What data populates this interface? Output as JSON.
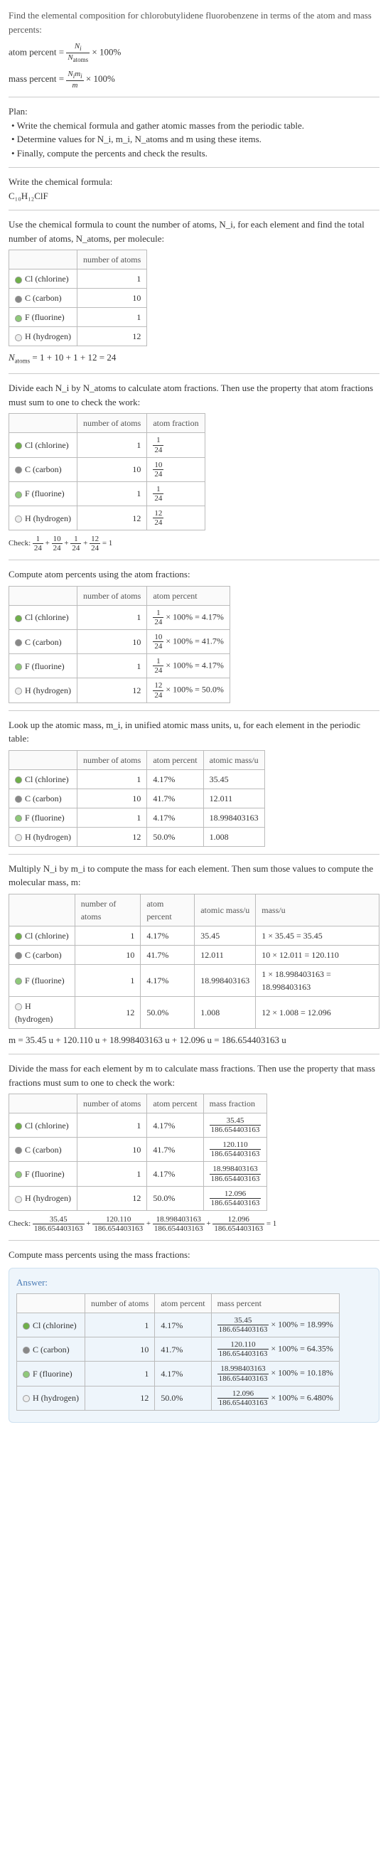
{
  "intro": {
    "prompt": "Find the elemental composition for chlorobutylidene fluorobenzene in terms of the atom and mass percents:",
    "atom_percent_label": "atom percent = ",
    "atom_percent_frac_num": "N_i",
    "atom_percent_frac_den": "N_atoms",
    "times100": " × 100%",
    "mass_percent_label": "mass percent = ",
    "mass_percent_frac_num": "N_i m_i",
    "mass_percent_frac_den": "m"
  },
  "plan": {
    "heading": "Plan:",
    "b1": "• Write the chemical formula and gather atomic masses from the periodic table.",
    "b2": "• Determine values for N_i, m_i, N_atoms and m using these items.",
    "b3": "• Finally, compute the percents and check the results."
  },
  "formula_step": {
    "text": "Write the chemical formula:",
    "formula": "C₁₀H₁₂ClF"
  },
  "count_step": {
    "text": "Use the chemical formula to count the number of atoms, N_i, for each element and find the total number of atoms, N_atoms, per molecule:",
    "header_natoms": "number of atoms",
    "rows": [
      {
        "color": "#6fb04a",
        "el": "Cl (chlorine)",
        "n": "1"
      },
      {
        "color": "#888888",
        "el": "C (carbon)",
        "n": "10"
      },
      {
        "color": "#8fc97a",
        "el": "F (fluorine)",
        "n": "1"
      },
      {
        "color": "#eeeeee",
        "el": "H (hydrogen)",
        "n": "12"
      }
    ],
    "sum": "N_atoms = 1 + 10 + 1 + 12 = 24"
  },
  "atomfrac_step": {
    "text": "Divide each N_i by N_atoms to calculate atom fractions. Then use the property that atom fractions must sum to one to check the work:",
    "header_natoms": "number of atoms",
    "header_frac": "atom fraction",
    "rows": [
      {
        "color": "#6fb04a",
        "el": "Cl (chlorine)",
        "n": "1",
        "fnum": "1",
        "fden": "24"
      },
      {
        "color": "#888888",
        "el": "C (carbon)",
        "n": "10",
        "fnum": "10",
        "fden": "24"
      },
      {
        "color": "#8fc97a",
        "el": "F (fluorine)",
        "n": "1",
        "fnum": "1",
        "fden": "24"
      },
      {
        "color": "#eeeeee",
        "el": "H (hydrogen)",
        "n": "12",
        "fnum": "12",
        "fden": "24"
      }
    ],
    "check_label": "Check: ",
    "check_expr": " = 1"
  },
  "atompct_step": {
    "text": "Compute atom percents using the atom fractions:",
    "header_natoms": "number of atoms",
    "header_pct": "atom percent",
    "rows": [
      {
        "color": "#6fb04a",
        "el": "Cl (chlorine)",
        "n": "1",
        "fnum": "1",
        "fden": "24",
        "pct": " × 100% = 4.17%"
      },
      {
        "color": "#888888",
        "el": "C (carbon)",
        "n": "10",
        "fnum": "10",
        "fden": "24",
        "pct": " × 100% = 41.7%"
      },
      {
        "color": "#8fc97a",
        "el": "F (fluorine)",
        "n": "1",
        "fnum": "1",
        "fden": "24",
        "pct": " × 100% = 4.17%"
      },
      {
        "color": "#eeeeee",
        "el": "H (hydrogen)",
        "n": "12",
        "fnum": "12",
        "fden": "24",
        "pct": " × 100% = 50.0%"
      }
    ]
  },
  "atommass_step": {
    "text": "Look up the atomic mass, m_i, in unified atomic mass units, u, for each element in the periodic table:",
    "header_natoms": "number of atoms",
    "header_pct": "atom percent",
    "header_mass": "atomic mass/u",
    "rows": [
      {
        "color": "#6fb04a",
        "el": "Cl (chlorine)",
        "n": "1",
        "pct": "4.17%",
        "mass": "35.45"
      },
      {
        "color": "#888888",
        "el": "C (carbon)",
        "n": "10",
        "pct": "41.7%",
        "mass": "12.011"
      },
      {
        "color": "#8fc97a",
        "el": "F (fluorine)",
        "n": "1",
        "pct": "4.17%",
        "mass": "18.998403163"
      },
      {
        "color": "#eeeeee",
        "el": "H (hydrogen)",
        "n": "12",
        "pct": "50.0%",
        "mass": "1.008"
      }
    ]
  },
  "molmass_step": {
    "text": "Multiply N_i by m_i to compute the mass for each element. Then sum those values to compute the molecular mass, m:",
    "header_natoms": "number of atoms",
    "header_pct": "atom percent",
    "header_amass": "atomic mass/u",
    "header_mass": "mass/u",
    "rows": [
      {
        "color": "#6fb04a",
        "el": "Cl (chlorine)",
        "n": "1",
        "pct": "4.17%",
        "amass": "35.45",
        "mass": "1 × 35.45 = 35.45"
      },
      {
        "color": "#888888",
        "el": "C (carbon)",
        "n": "10",
        "pct": "41.7%",
        "amass": "12.011",
        "mass": "10 × 12.011 = 120.110"
      },
      {
        "color": "#8fc97a",
        "el": "F (fluorine)",
        "n": "1",
        "pct": "4.17%",
        "amass": "18.998403163",
        "mass": "1 × 18.998403163 = 18.998403163"
      },
      {
        "color": "#eeeeee",
        "el": "H (hydrogen)",
        "n": "12",
        "pct": "50.0%",
        "amass": "1.008",
        "mass": "12 × 1.008 = 12.096"
      }
    ],
    "sum": "m = 35.45 u + 120.110 u + 18.998403163 u + 12.096 u = 186.654403163 u"
  },
  "massfrac_step": {
    "text": "Divide the mass for each element by m to calculate mass fractions. Then use the property that mass fractions must sum to one to check the work:",
    "header_natoms": "number of atoms",
    "header_pct": "atom percent",
    "header_mfrac": "mass fraction",
    "rows": [
      {
        "color": "#6fb04a",
        "el": "Cl (chlorine)",
        "n": "1",
        "pct": "4.17%",
        "fnum": "35.45",
        "fden": "186.654403163"
      },
      {
        "color": "#888888",
        "el": "C (carbon)",
        "n": "10",
        "pct": "41.7%",
        "fnum": "120.110",
        "fden": "186.654403163"
      },
      {
        "color": "#8fc97a",
        "el": "F (fluorine)",
        "n": "1",
        "pct": "4.17%",
        "fnum": "18.998403163",
        "fden": "186.654403163"
      },
      {
        "color": "#eeeeee",
        "el": "H (hydrogen)",
        "n": "12",
        "pct": "50.0%",
        "fnum": "12.096",
        "fden": "186.654403163"
      }
    ],
    "check_label": "Check: ",
    "check_expr": " = 1"
  },
  "masspct_step": {
    "text": "Compute mass percents using the mass fractions:"
  },
  "answer": {
    "label": "Answer:",
    "header_natoms": "number of atoms",
    "header_apct": "atom percent",
    "header_mpct": "mass percent",
    "rows": [
      {
        "color": "#6fb04a",
        "el": "Cl (chlorine)",
        "n": "1",
        "apct": "4.17%",
        "fnum": "35.45",
        "fden": "186.654403163",
        "suffix": " × 100% = 18.99%"
      },
      {
        "color": "#888888",
        "el": "C (carbon)",
        "n": "10",
        "apct": "41.7%",
        "fnum": "120.110",
        "fden": "186.654403163",
        "suffix": " × 100% = 64.35%"
      },
      {
        "color": "#8fc97a",
        "el": "F (fluorine)",
        "n": "1",
        "apct": "4.17%",
        "fnum": "18.998403163",
        "fden": "186.654403163",
        "suffix": " × 100% = 10.18%"
      },
      {
        "color": "#eeeeee",
        "el": "H (hydrogen)",
        "n": "12",
        "apct": "50.0%",
        "fnum": "12.096",
        "fden": "186.654403163",
        "suffix": " × 100% = 6.480%"
      }
    ]
  },
  "chart_data": {
    "type": "table",
    "title": "Elemental composition of chlorobutylidene fluorobenzene (C10H12ClF)",
    "molecular_mass_u": 186.654403163,
    "N_atoms": 24,
    "elements": [
      {
        "symbol": "Cl",
        "name": "chlorine",
        "N_i": 1,
        "atom_fraction": 0.0417,
        "atom_percent": 4.17,
        "atomic_mass_u": 35.45,
        "mass_u": 35.45,
        "mass_fraction": 0.1899,
        "mass_percent": 18.99
      },
      {
        "symbol": "C",
        "name": "carbon",
        "N_i": 10,
        "atom_fraction": 0.4167,
        "atom_percent": 41.7,
        "atomic_mass_u": 12.011,
        "mass_u": 120.11,
        "mass_fraction": 0.6435,
        "mass_percent": 64.35
      },
      {
        "symbol": "F",
        "name": "fluorine",
        "N_i": 1,
        "atom_fraction": 0.0417,
        "atom_percent": 4.17,
        "atomic_mass_u": 18.998403163,
        "mass_u": 18.998403163,
        "mass_fraction": 0.1018,
        "mass_percent": 10.18
      },
      {
        "symbol": "H",
        "name": "hydrogen",
        "N_i": 12,
        "atom_fraction": 0.5,
        "atom_percent": 50.0,
        "atomic_mass_u": 1.008,
        "mass_u": 12.096,
        "mass_fraction": 0.0648,
        "mass_percent": 6.48
      }
    ]
  }
}
